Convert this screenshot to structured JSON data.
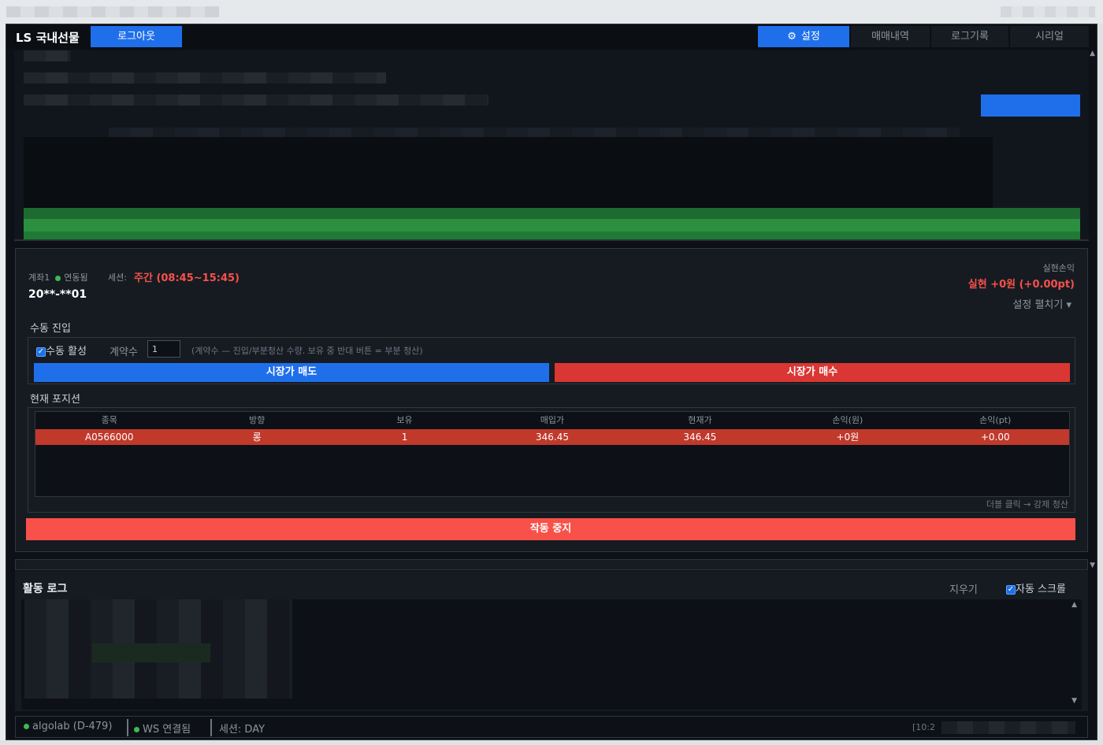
{
  "nav": {
    "brand": "LS 국내선물",
    "logout": "로그아웃",
    "tabs": [
      {
        "label": "설정",
        "icon": "gear-icon",
        "active": true
      },
      {
        "label": "매매내역",
        "active": false
      },
      {
        "label": "로그기록",
        "active": false
      },
      {
        "label": "시리얼",
        "active": false
      }
    ]
  },
  "account": {
    "label": "계좌1",
    "link_status": "연동됨",
    "session_label": "세션:",
    "session_value": "주간 (08:45~15:45)",
    "number": "20**-**01",
    "pnl_label": "실현손익",
    "pnl_value": "실현 +0원 (+0.00pt)",
    "expand": "설정 펼치기 ▾"
  },
  "manual": {
    "title": "수동 진입",
    "toggle_label": "수동 활성",
    "toggle_checked": true,
    "qty_label": "계약수",
    "qty_value": "1",
    "hint": "(계약수 — 진입/부분청산 수량. 보유 중 반대 버튼 = 부분 청산)",
    "sell_label": "시장가 매도",
    "buy_label": "시장가 매수"
  },
  "position": {
    "title": "현재 포지션",
    "columns": [
      "종목",
      "방향",
      "보유",
      "매입가",
      "현재가",
      "손익(원)",
      "손익(pt)"
    ],
    "rows": [
      [
        "A0566000",
        "롱",
        "1",
        "346.45",
        "346.45",
        "+0원",
        "+0.00"
      ]
    ],
    "hint": "더블 클릭 → 강제 청산"
  },
  "stop_label": "작동 중지",
  "log": {
    "title": "활동 로그",
    "clear": "지우기",
    "auto_scroll": "자동 스크롤",
    "auto_scroll_checked": true
  },
  "status": {
    "user": "algolab (D-479)",
    "ws": "WS 연결됨",
    "session": "세션: DAY",
    "time": "[10:2"
  },
  "colors": {
    "accent": "#1f6feb",
    "danger": "#f85149",
    "ok": "#3fb950",
    "background": "#0d1117"
  }
}
